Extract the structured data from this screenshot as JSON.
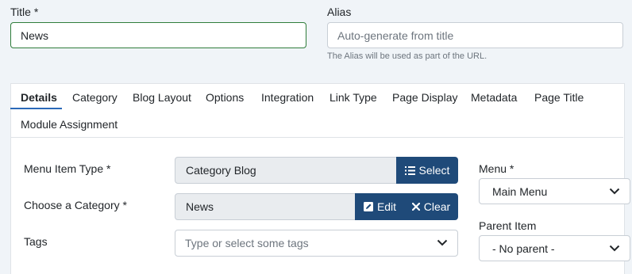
{
  "title_field": {
    "label": "Title *",
    "value": "News"
  },
  "alias_field": {
    "label": "Alias",
    "placeholder": "Auto-generate from title",
    "help": "The Alias will be used as part of the URL."
  },
  "tabs": [
    {
      "label": "Details",
      "active": true
    },
    {
      "label": "Category"
    },
    {
      "label": "Blog Layout"
    },
    {
      "label": "Options"
    },
    {
      "label": "Integration"
    },
    {
      "label": "Link Type"
    },
    {
      "label": "Page Display"
    },
    {
      "label": "Metadata"
    },
    {
      "label": "Page Title"
    },
    {
      "label": "Module Assignment"
    }
  ],
  "details": {
    "menu_item_type": {
      "label": "Menu Item Type *",
      "value": "Category Blog",
      "select_label": "Select"
    },
    "category": {
      "label": "Choose a Category *",
      "value": "News",
      "edit_label": "Edit",
      "clear_label": "Clear"
    },
    "tags": {
      "label": "Tags",
      "placeholder": "Type or select some tags"
    }
  },
  "sidebar": {
    "menu": {
      "label": "Menu *",
      "value": "Main Menu"
    },
    "parent_item": {
      "label": "Parent Item",
      "value": "- No parent -"
    }
  },
  "colors": {
    "accent": "#1f4a79",
    "focus_border": "#2f7d3b",
    "tab_underline": "#2a69b8"
  }
}
